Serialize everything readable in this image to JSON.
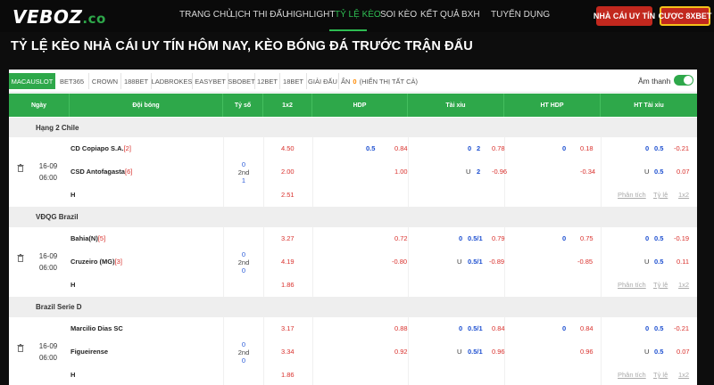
{
  "header": {
    "logo_main": "VEBOZ",
    "logo_suffix": ".co",
    "nav": [
      "TRANG CHỦ",
      "LỊCH THI ĐẤU",
      "HIGHLIGHT",
      "TỶ LỆ KÈO",
      "SOI KÈO",
      "KẾT QUẢ",
      "BXH",
      "TUYỂN DỤNG"
    ],
    "active_nav": "TỶ LỆ KÈO",
    "btn_left": "NHÀ CÁI UY TÍN",
    "btn_right": "CƯỢC 8XBET"
  },
  "page_title": "TỶ LỆ KÈO NHÀ CÁI UY TÍN HÔM NAY, KÈO BÓNG ĐÁ TRƯỚC TRẬN ĐẤU",
  "bookmakers": [
    "MACAUSLOT",
    "BET365",
    "CROWN",
    "188BET",
    "LADBROKES",
    "EASYBET",
    "SBOBET",
    "12BET",
    "18BET",
    "GIẢI ĐẤU"
  ],
  "hidden": {
    "label": "ẨN",
    "count": "0",
    "show_all": "(HIỂN THỊ TẤT CẢ)"
  },
  "sound_label": "Âm thanh",
  "columns": [
    "Ngày",
    "Đội bóng",
    "Tỷ số",
    "1x2",
    "HDP",
    "Tài xỉu",
    "HT HDP",
    "HT Tài xỉu"
  ],
  "links": {
    "analysis": "Phân tích",
    "ratio": "Tỷ lệ",
    "x12": "1x2"
  },
  "colors": {
    "green": "#2ea84a",
    "red": "#c2281e",
    "yellow": "#f3c21a"
  },
  "leagues": [
    {
      "name": "Hạng 2 Chile",
      "match": {
        "date": "16-09",
        "time": "06:00",
        "home": "CD Copiapo S.A.",
        "home_rank": "[2]",
        "away": "CSD Antofagasta",
        "away_rank": "[6]",
        "score_home": "0",
        "score_mid": "2nd",
        "score_away": "1",
        "draw_label": "H",
        "x12": [
          "4.50",
          "2.00",
          "2.51"
        ],
        "hdp_home": [
          "0.5",
          "0.84"
        ],
        "hdp_away": [
          "",
          "1.00"
        ],
        "tx_home": [
          "0",
          "2",
          "0.78"
        ],
        "tx_away": [
          "U",
          "2",
          "-0.96"
        ],
        "hthdp_home": [
          "0",
          "0.18"
        ],
        "hthdp_away": [
          "",
          "-0.34"
        ],
        "httx_home": [
          "0",
          "0.5",
          "-0.21"
        ],
        "httx_away": [
          "U",
          "0.5",
          "0.07"
        ]
      }
    },
    {
      "name": "VĐQG Brazil",
      "match": {
        "date": "16-09",
        "time": "06:00",
        "home": "Bahia(N)",
        "home_rank": "[5]",
        "away": "Cruzeiro (MG)",
        "away_rank": "[3]",
        "score_home": "0",
        "score_mid": "2nd",
        "score_away": "0",
        "draw_label": "H",
        "x12": [
          "3.27",
          "4.19",
          "1.86"
        ],
        "hdp_home": [
          "",
          "0.72"
        ],
        "hdp_away": [
          "",
          "-0.80"
        ],
        "tx_home": [
          "0",
          "0.5/1",
          "0.79"
        ],
        "tx_away": [
          "U",
          "0.5/1",
          "-0.89"
        ],
        "hthdp_home": [
          "0",
          "0.75"
        ],
        "hthdp_away": [
          "",
          "-0.85"
        ],
        "httx_home": [
          "0",
          "0.5",
          "-0.19"
        ],
        "httx_away": [
          "U",
          "0.5",
          "0.11"
        ]
      }
    },
    {
      "name": "Brazil Serie D",
      "match": {
        "date": "16-09",
        "time": "06:00",
        "home": "Marcilio Dias SC",
        "home_rank": "",
        "away": "Figueirense",
        "away_rank": "",
        "score_home": "0",
        "score_mid": "2nd",
        "score_away": "0",
        "draw_label": "H",
        "x12": [
          "3.17",
          "3.34",
          "1.86"
        ],
        "hdp_home": [
          "",
          "0.88"
        ],
        "hdp_away": [
          "",
          "0.92"
        ],
        "tx_home": [
          "0",
          "0.5/1",
          "0.84"
        ],
        "tx_away": [
          "U",
          "0.5/1",
          "0.96"
        ],
        "hthdp_home": [
          "0",
          "0.84"
        ],
        "hthdp_away": [
          "",
          "0.96"
        ],
        "httx_home": [
          "0",
          "0.5",
          "-0.21"
        ],
        "httx_away": [
          "U",
          "0.5",
          "0.07"
        ]
      }
    }
  ]
}
